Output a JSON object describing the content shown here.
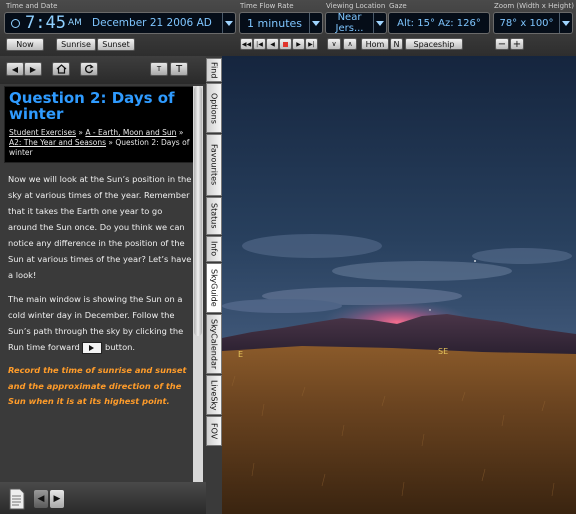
{
  "toolbar": {
    "time_date": {
      "group_label": "Time and Date",
      "time": "7:45",
      "ampm": "AM",
      "date": "December 21 2006 AD",
      "buttons": [
        "Now",
        "Sunrise",
        "Sunset"
      ]
    },
    "time_flow": {
      "group_label": "Time Flow Rate",
      "value": "1 minutes"
    },
    "location": {
      "group_label": "Viewing Location",
      "value": "Near Jers..."
    },
    "gaze": {
      "group_label": "Gaze",
      "value": "Alt: 15° Az: 126°"
    },
    "zoom": {
      "group_label": "Zoom (Width x Height)",
      "value": "78° x 100°"
    },
    "home_label": "Hom",
    "n_label": "N",
    "spaceship_label": "Spaceship",
    "stop_color": "#e0342c"
  },
  "panel": {
    "title": "Question 2: Days of winter",
    "breadcrumb": {
      "c1": "Student Exercises",
      "sep1": " » ",
      "c2": "A - Earth, Moon and Sun",
      "sep2": " » ",
      "c3": "A2: The Year and Seasons",
      "sep3": " » ",
      "c4": "Question 2: Days of winter"
    },
    "para1": "Now we will look at the Sun’s position in the sky at various times of the year. Remember that it takes the Earth one year to go around the Sun once. Do you think we can notice any difference in the position of the Sun at various times of the year? Let’s have a look!",
    "para2": "The main window is showing the Sun on a cold winter day in December. Follow the Sun’s path through the sky by clicking the Run time forward",
    "para2_end": "button.",
    "instruction": "Record the time of sunrise and sunset and the approximate direction of the Sun when it is at its highest point.",
    "title_color": "#2f9bff",
    "instruction_color": "#ff9c2a"
  },
  "tabs": [
    "Find",
    "Options",
    "Favourites",
    "Status",
    "Info",
    "SkyGuide",
    "SkyCalendar",
    "LiveSky",
    "FOV"
  ],
  "active_tab": "SkyGuide",
  "sky": {
    "labels": {
      "east": "E",
      "southeast": "SE"
    },
    "label_color": "#e6c45a"
  }
}
